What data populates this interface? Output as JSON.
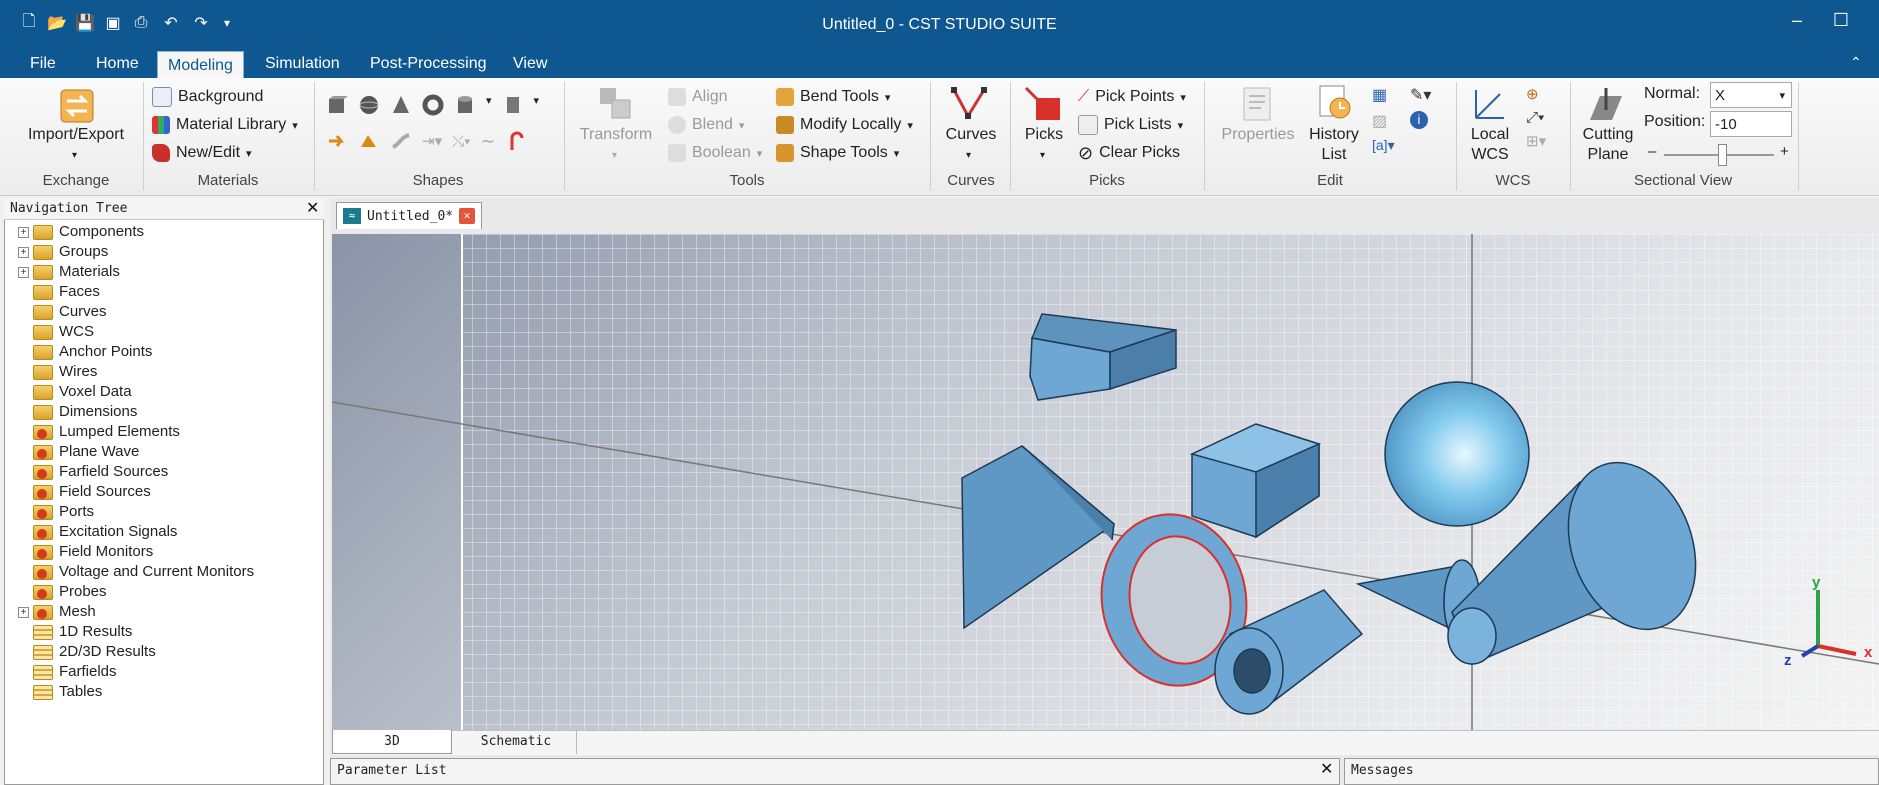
{
  "window": {
    "title": "Untitled_0 - CST STUDIO SUITE",
    "minimize": "–",
    "maximize": "☐"
  },
  "quick_access": [
    "new-file-icon",
    "open-folder-icon",
    "save-icon",
    "save-all-icon",
    "print-icon",
    "undo-icon",
    "redo-icon",
    "customize-icon"
  ],
  "menu": {
    "tabs": [
      "File",
      "Home",
      "Modeling",
      "Simulation",
      "Post-Processing",
      "View"
    ],
    "active": "Modeling"
  },
  "ribbon": {
    "exchange": {
      "button": "Import/Export",
      "group": "Exchange"
    },
    "materials": {
      "background": "Background",
      "library": "Material Library",
      "new_edit": "New/Edit",
      "group": "Materials"
    },
    "shapes": {
      "group": "Shapes"
    },
    "tools": {
      "transform": "Transform",
      "align": "Align",
      "blend": "Blend",
      "boolean": "Boolean",
      "bend": "Bend Tools",
      "modify": "Modify Locally",
      "shape_tools": "Shape Tools",
      "group": "Tools"
    },
    "curves": {
      "button": "Curves",
      "group": "Curves"
    },
    "picks": {
      "button": "Picks",
      "pick_points": "Pick Points",
      "pick_lists": "Pick Lists",
      "clear": "Clear Picks",
      "group": "Picks"
    },
    "edit": {
      "properties": "Properties",
      "history_1": "History",
      "history_2": "List",
      "group": "Edit"
    },
    "wcs": {
      "local_1": "Local",
      "local_2": "WCS",
      "group": "WCS"
    },
    "sectional": {
      "cutting_1": "Cutting",
      "cutting_2": "Plane",
      "normal_label": "Normal:",
      "normal_value": "X",
      "position_label": "Position:",
      "position_value": "-10",
      "minus": "–",
      "plus": "+",
      "group": "Sectional View"
    }
  },
  "nav": {
    "title": "Navigation Tree",
    "items": [
      {
        "label": "Components",
        "expand": true,
        "icon": "folder"
      },
      {
        "label": "Groups",
        "expand": true,
        "icon": "folder"
      },
      {
        "label": "Materials",
        "expand": true,
        "icon": "folder"
      },
      {
        "label": "Faces",
        "expand": false,
        "icon": "folder"
      },
      {
        "label": "Curves",
        "expand": false,
        "icon": "folder"
      },
      {
        "label": "WCS",
        "expand": false,
        "icon": "folder"
      },
      {
        "label": "Anchor Points",
        "expand": false,
        "icon": "folder"
      },
      {
        "label": "Wires",
        "expand": false,
        "icon": "folder"
      },
      {
        "label": "Voxel Data",
        "expand": false,
        "icon": "folder"
      },
      {
        "label": "Dimensions",
        "expand": false,
        "icon": "folder"
      },
      {
        "label": "Lumped Elements",
        "expand": false,
        "icon": "red"
      },
      {
        "label": "Plane Wave",
        "expand": false,
        "icon": "red"
      },
      {
        "label": "Farfield Sources",
        "expand": false,
        "icon": "red"
      },
      {
        "label": "Field Sources",
        "expand": false,
        "icon": "red"
      },
      {
        "label": "Ports",
        "expand": false,
        "icon": "red"
      },
      {
        "label": "Excitation Signals",
        "expand": false,
        "icon": "red"
      },
      {
        "label": "Field Monitors",
        "expand": false,
        "icon": "red"
      },
      {
        "label": "Voltage and Current Monitors",
        "expand": false,
        "icon": "red"
      },
      {
        "label": "Probes",
        "expand": false,
        "icon": "red"
      },
      {
        "label": "Mesh",
        "expand": true,
        "icon": "red"
      },
      {
        "label": "1D Results",
        "expand": false,
        "icon": "res"
      },
      {
        "label": "2D/3D Results",
        "expand": false,
        "icon": "res"
      },
      {
        "label": "Farfields",
        "expand": false,
        "icon": "res"
      },
      {
        "label": "Tables",
        "expand": false,
        "icon": "res"
      }
    ]
  },
  "document": {
    "tab": "Untitled_0*"
  },
  "view_tabs": [
    "3D",
    "Schematic"
  ],
  "axes": {
    "x": "x",
    "y": "y",
    "z": "z"
  },
  "panels": {
    "parameter_list": "Parameter List",
    "messages": "Messages"
  },
  "colors": {
    "title_bar": "#0f5790",
    "shape_fill": "#6aa4d2",
    "pick_red": "#d9302b"
  }
}
